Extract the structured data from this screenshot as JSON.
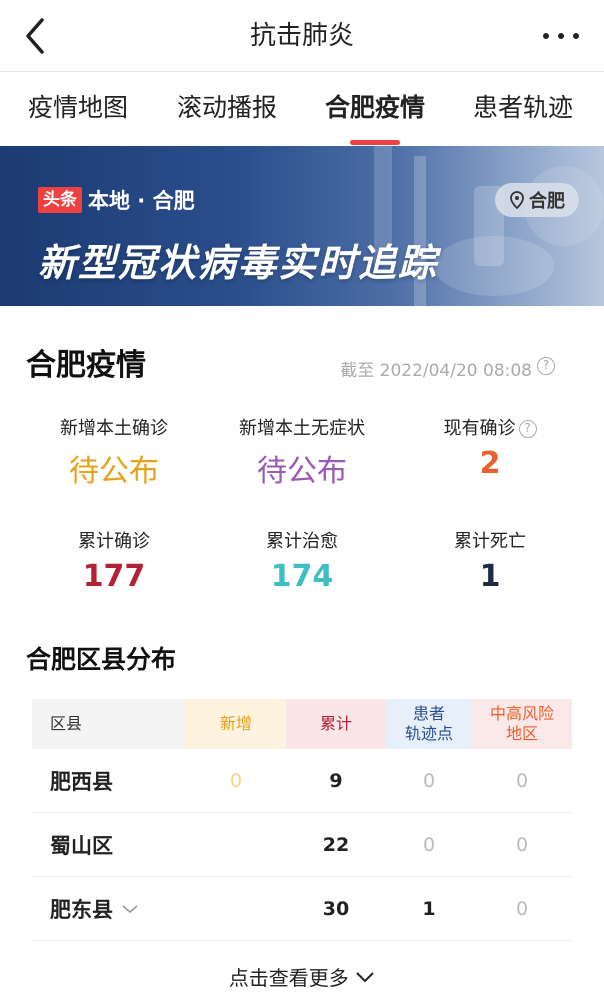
{
  "header": {
    "title": "抗击肺炎"
  },
  "tabs": [
    {
      "label": "疫情地图"
    },
    {
      "label": "滚动播报"
    },
    {
      "label": "合肥疫情"
    },
    {
      "label": "患者轨迹"
    }
  ],
  "banner": {
    "brand_tag": "头条",
    "brand_text": "本地 · 合肥",
    "location": "合肥",
    "headline": "新型冠状病毒实时追踪"
  },
  "overview": {
    "title": "合肥疫情",
    "as_of": "截至 2022/04/20 08:08",
    "stats": [
      {
        "label": "新增本土确诊",
        "value": "待公布",
        "color": "#e8a21a"
      },
      {
        "label": "新增本土无症状",
        "value": "待公布",
        "color": "#9b59b6"
      },
      {
        "label": "现有确诊",
        "value": "2",
        "color": "#e8612c"
      },
      {
        "label": "累计确诊",
        "value": "177",
        "color": "#b22234"
      },
      {
        "label": "累计治愈",
        "value": "174",
        "color": "#3fbfbf"
      },
      {
        "label": "累计死亡",
        "value": "1",
        "color": "#1c2a48"
      }
    ]
  },
  "districts": {
    "title": "合肥区县分布",
    "headers": {
      "name": "区县",
      "new": "新增",
      "total": "累计",
      "track_line1": "患者",
      "track_line2": "轨迹点",
      "risk_line1": "中高风险",
      "risk_line2": "地区"
    },
    "rows": [
      {
        "name": "肥西县",
        "new": "0",
        "total": "9",
        "track": "0",
        "risk": "0"
      },
      {
        "name": "蜀山区",
        "new": "",
        "total": "22",
        "track": "0",
        "risk": "0"
      },
      {
        "name": "肥东县",
        "new": "",
        "total": "30",
        "track": "1",
        "risk": "0"
      }
    ],
    "more_label": "点击查看更多"
  }
}
